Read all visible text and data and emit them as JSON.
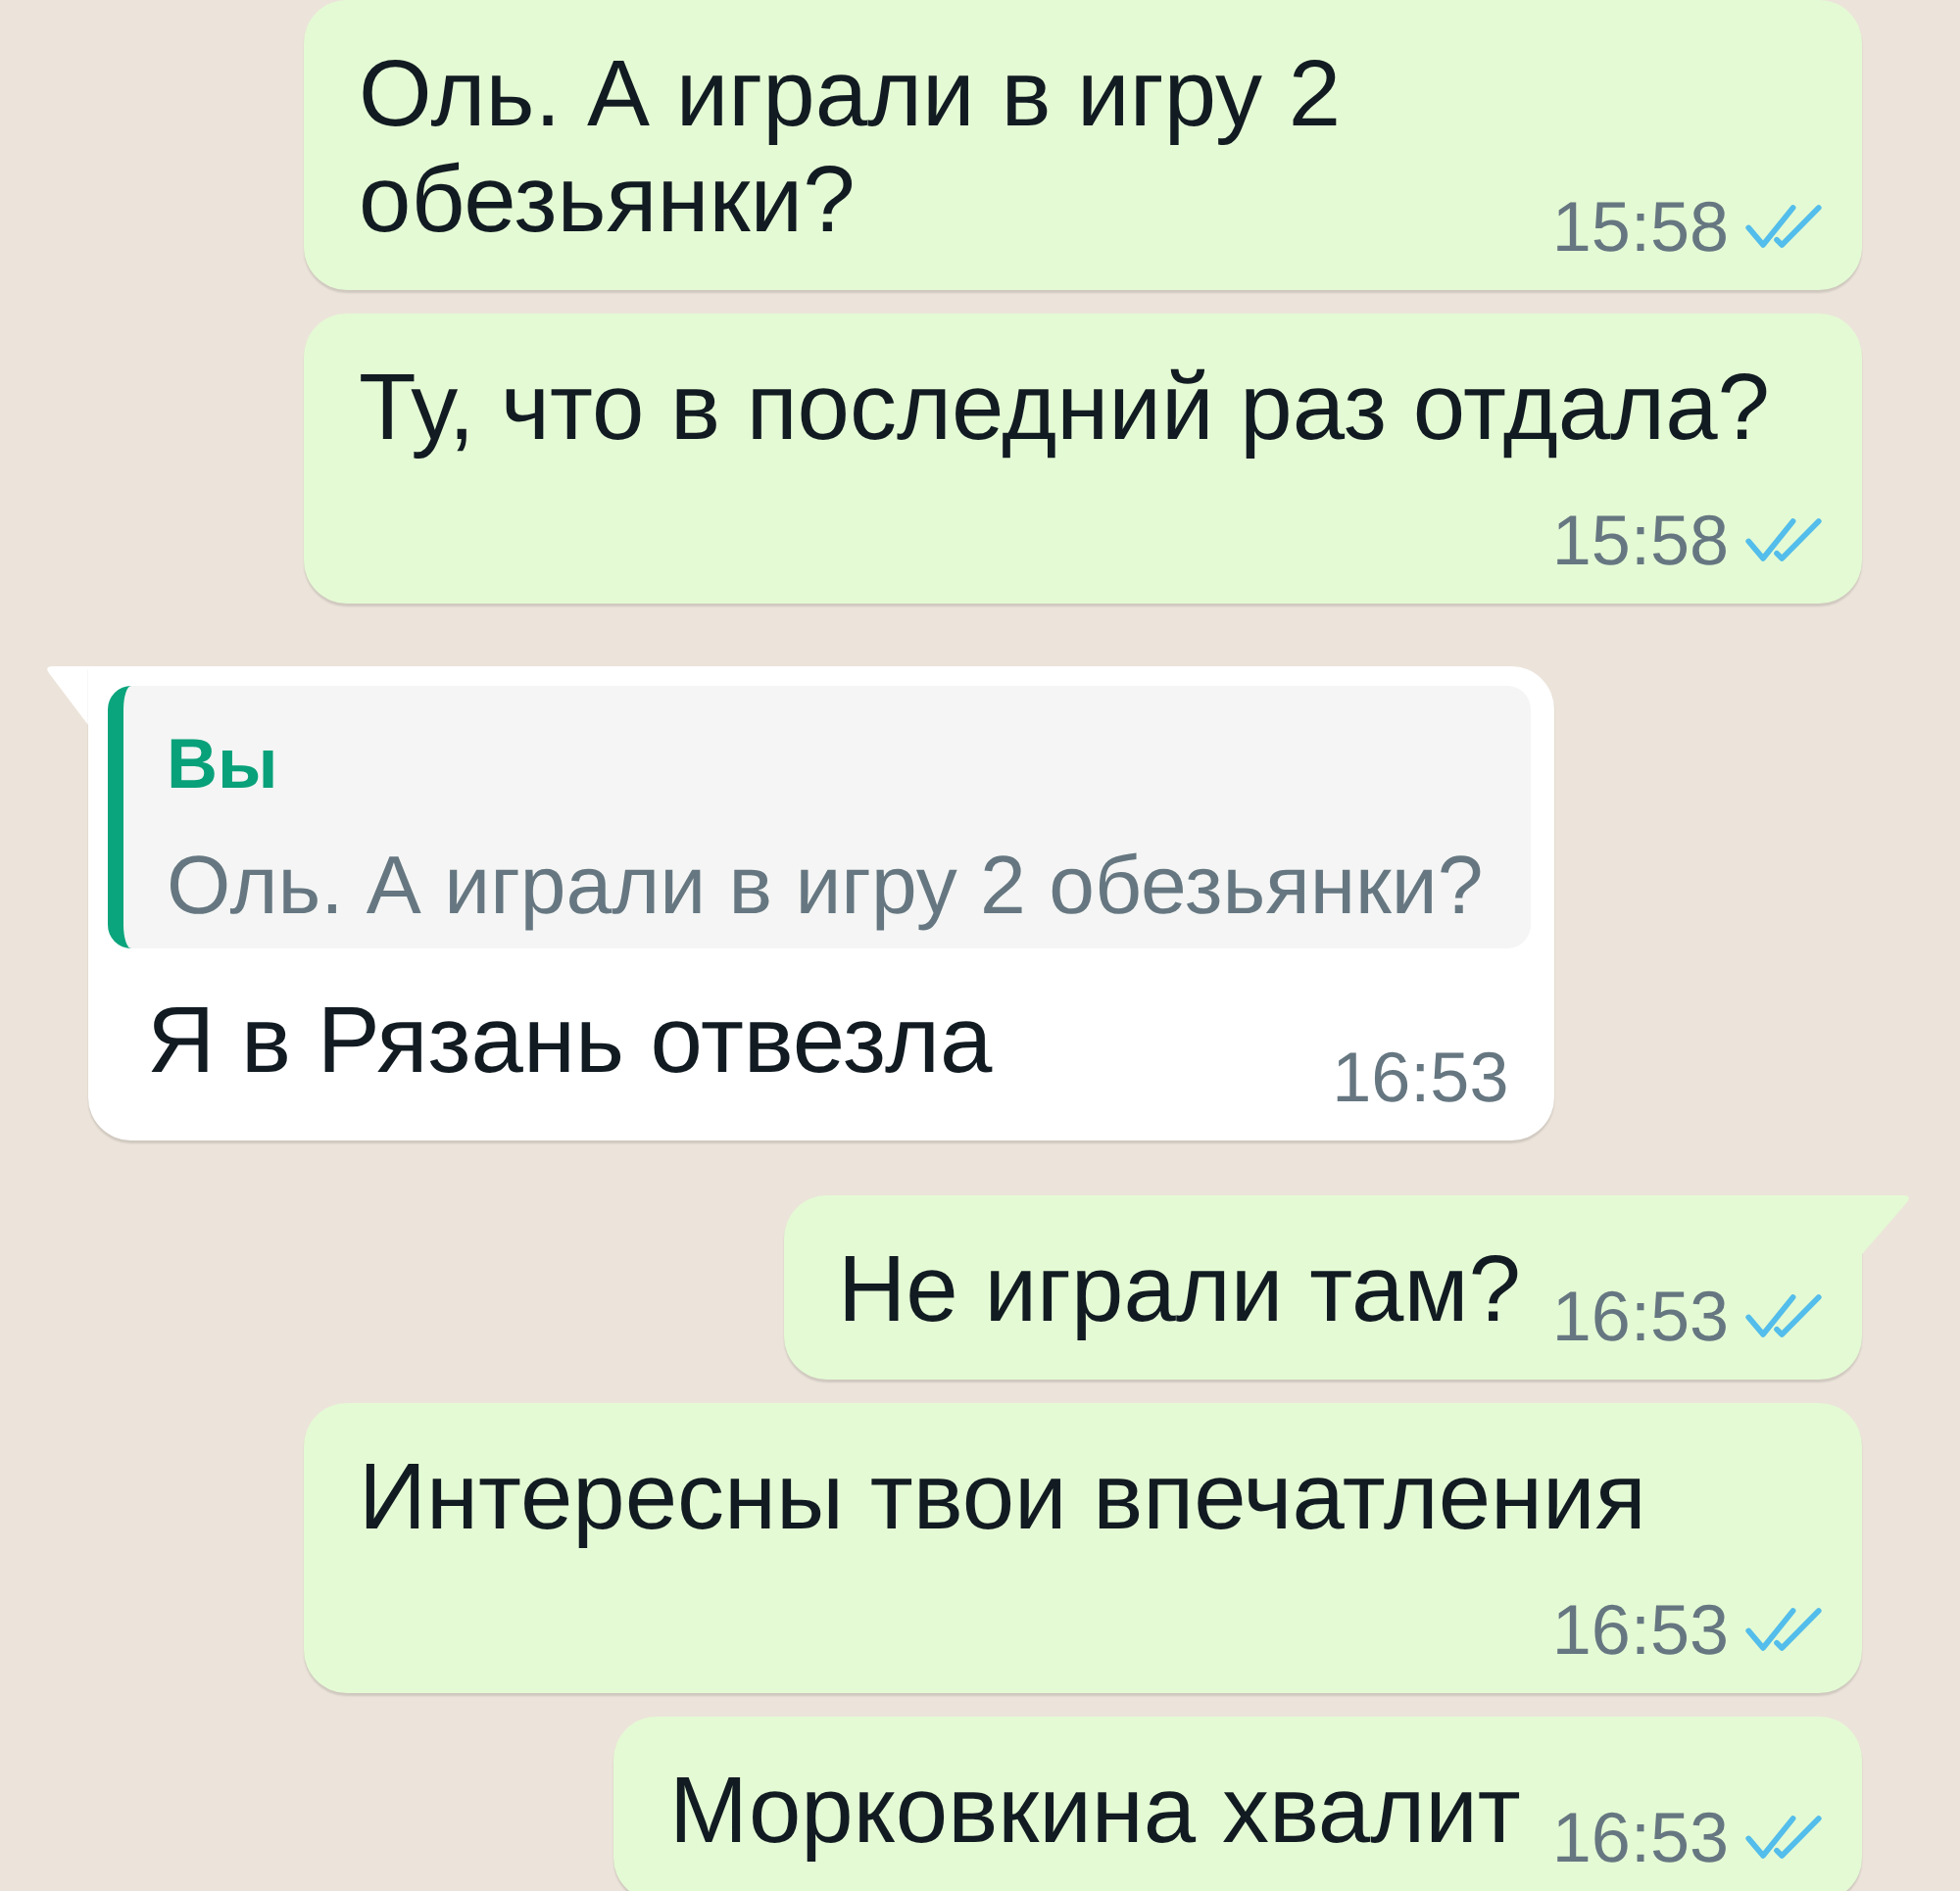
{
  "messages": [
    {
      "kind": "outgoing",
      "tail": false,
      "text": "Оль. А играли в игру 2 обезьянки?",
      "time": "15:58",
      "read": true
    },
    {
      "kind": "outgoing",
      "tail": false,
      "text": "Ту, что в последний раз отдала?",
      "time": "15:58",
      "read": true
    },
    {
      "kind": "incoming",
      "tail": true,
      "quote": {
        "author": "Вы",
        "text": "Оль. А играли в игру 2 обезьянки?"
      },
      "text": "Я в Рязань отвезла",
      "time": "16:53"
    },
    {
      "kind": "outgoing",
      "tail": true,
      "text": "Не играли там?",
      "time": "16:53",
      "read": true
    },
    {
      "kind": "outgoing",
      "tail": false,
      "text": "Интересны твои впечатления",
      "time": "16:53",
      "read": true
    },
    {
      "kind": "outgoing",
      "tail": false,
      "text": "Морковкина хвалит",
      "time": "16:53",
      "read": true
    }
  ]
}
